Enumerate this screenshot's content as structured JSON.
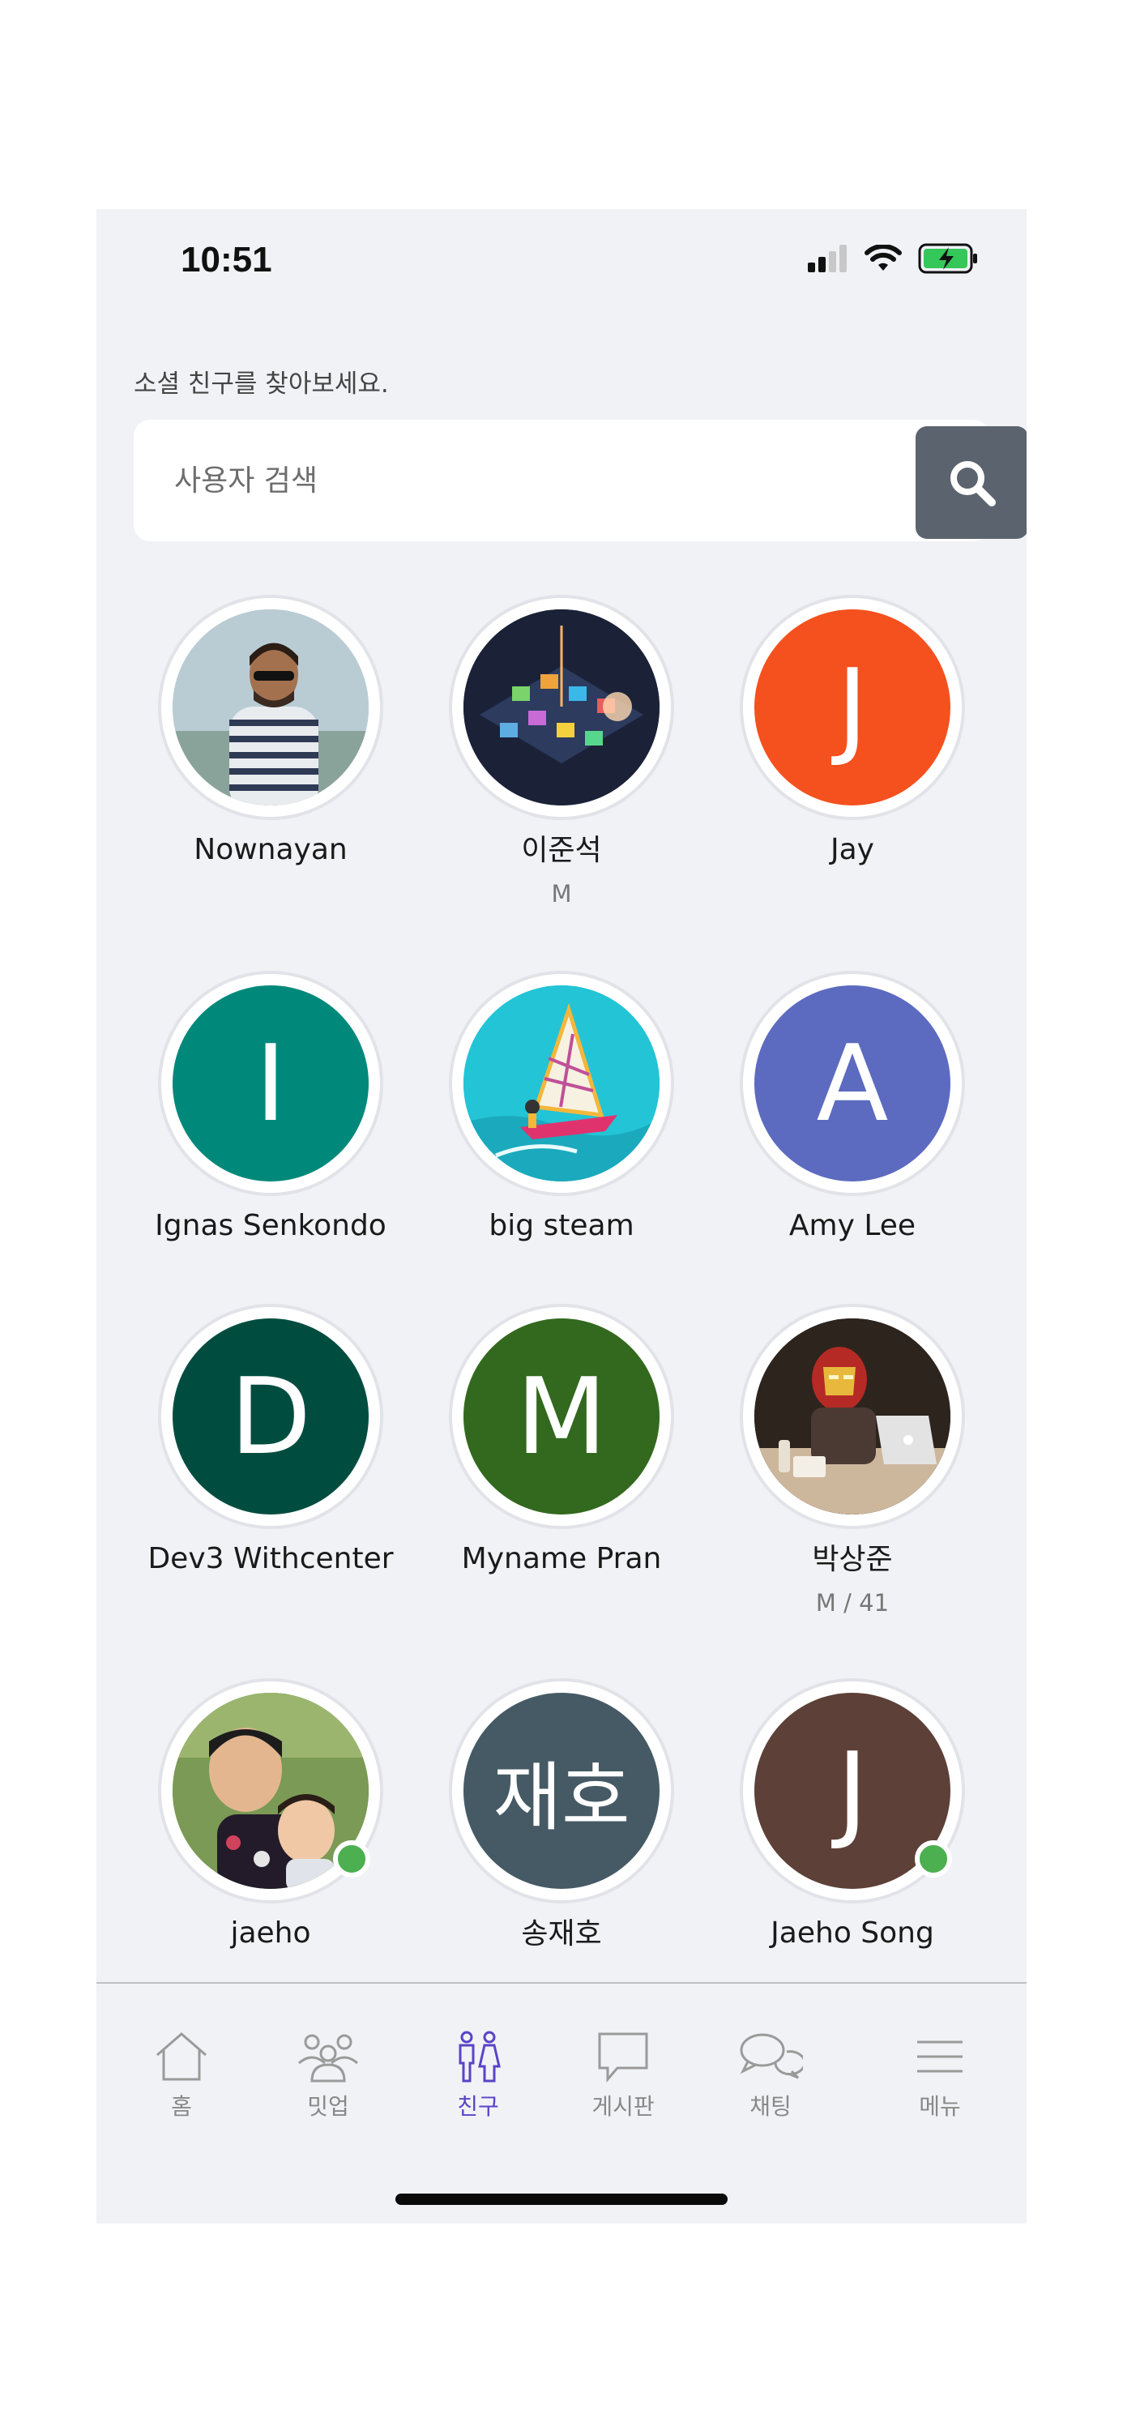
{
  "status_bar": {
    "time": "10:51"
  },
  "header": {
    "subtitle": "소셜 친구를 찾아보세요."
  },
  "search": {
    "placeholder": "사용자 검색"
  },
  "friends": [
    {
      "name": "Nownayan",
      "meta": "",
      "avatar": "photo-man-striped-shirt"
    },
    {
      "name": "이준석",
      "meta": "M",
      "avatar": "photo-tech-city"
    },
    {
      "name": "Jay",
      "meta": "",
      "initial": "J",
      "color": "#f4511e"
    },
    {
      "name": "Ignas Senkondo",
      "meta": "",
      "initial": "I",
      "color": "#00897b"
    },
    {
      "name": "big steam",
      "meta": "",
      "avatar": "photo-windsurf"
    },
    {
      "name": "Amy Lee",
      "meta": "",
      "initial": "A",
      "color": "#5c6bc0"
    },
    {
      "name": "Dev3 Withcenter",
      "meta": "",
      "initial": "D",
      "color": "#004d40"
    },
    {
      "name": "Myname Pran",
      "meta": "",
      "initial": "M",
      "color": "#33691e"
    },
    {
      "name": "박상준",
      "meta": "M / 41",
      "avatar": "photo-iron-man"
    },
    {
      "name": "jaeho",
      "meta": "",
      "avatar": "photo-father-child",
      "online": true
    },
    {
      "name": "송재호",
      "meta": "",
      "initial": "재호",
      "color": "#455a64"
    },
    {
      "name": "Jaeho Song",
      "meta": "",
      "initial": "J",
      "color": "#5d4037",
      "online": true
    }
  ],
  "tabbar": {
    "items": [
      {
        "label": "홈",
        "icon": "home-icon",
        "active": false
      },
      {
        "label": "밋업",
        "icon": "meetup-icon",
        "active": false
      },
      {
        "label": "친구",
        "icon": "friends-icon",
        "active": true
      },
      {
        "label": "게시판",
        "icon": "board-icon",
        "active": false
      },
      {
        "label": "채팅",
        "icon": "chat-icon",
        "active": false
      },
      {
        "label": "메뉴",
        "icon": "menu-icon",
        "active": false
      }
    ]
  }
}
